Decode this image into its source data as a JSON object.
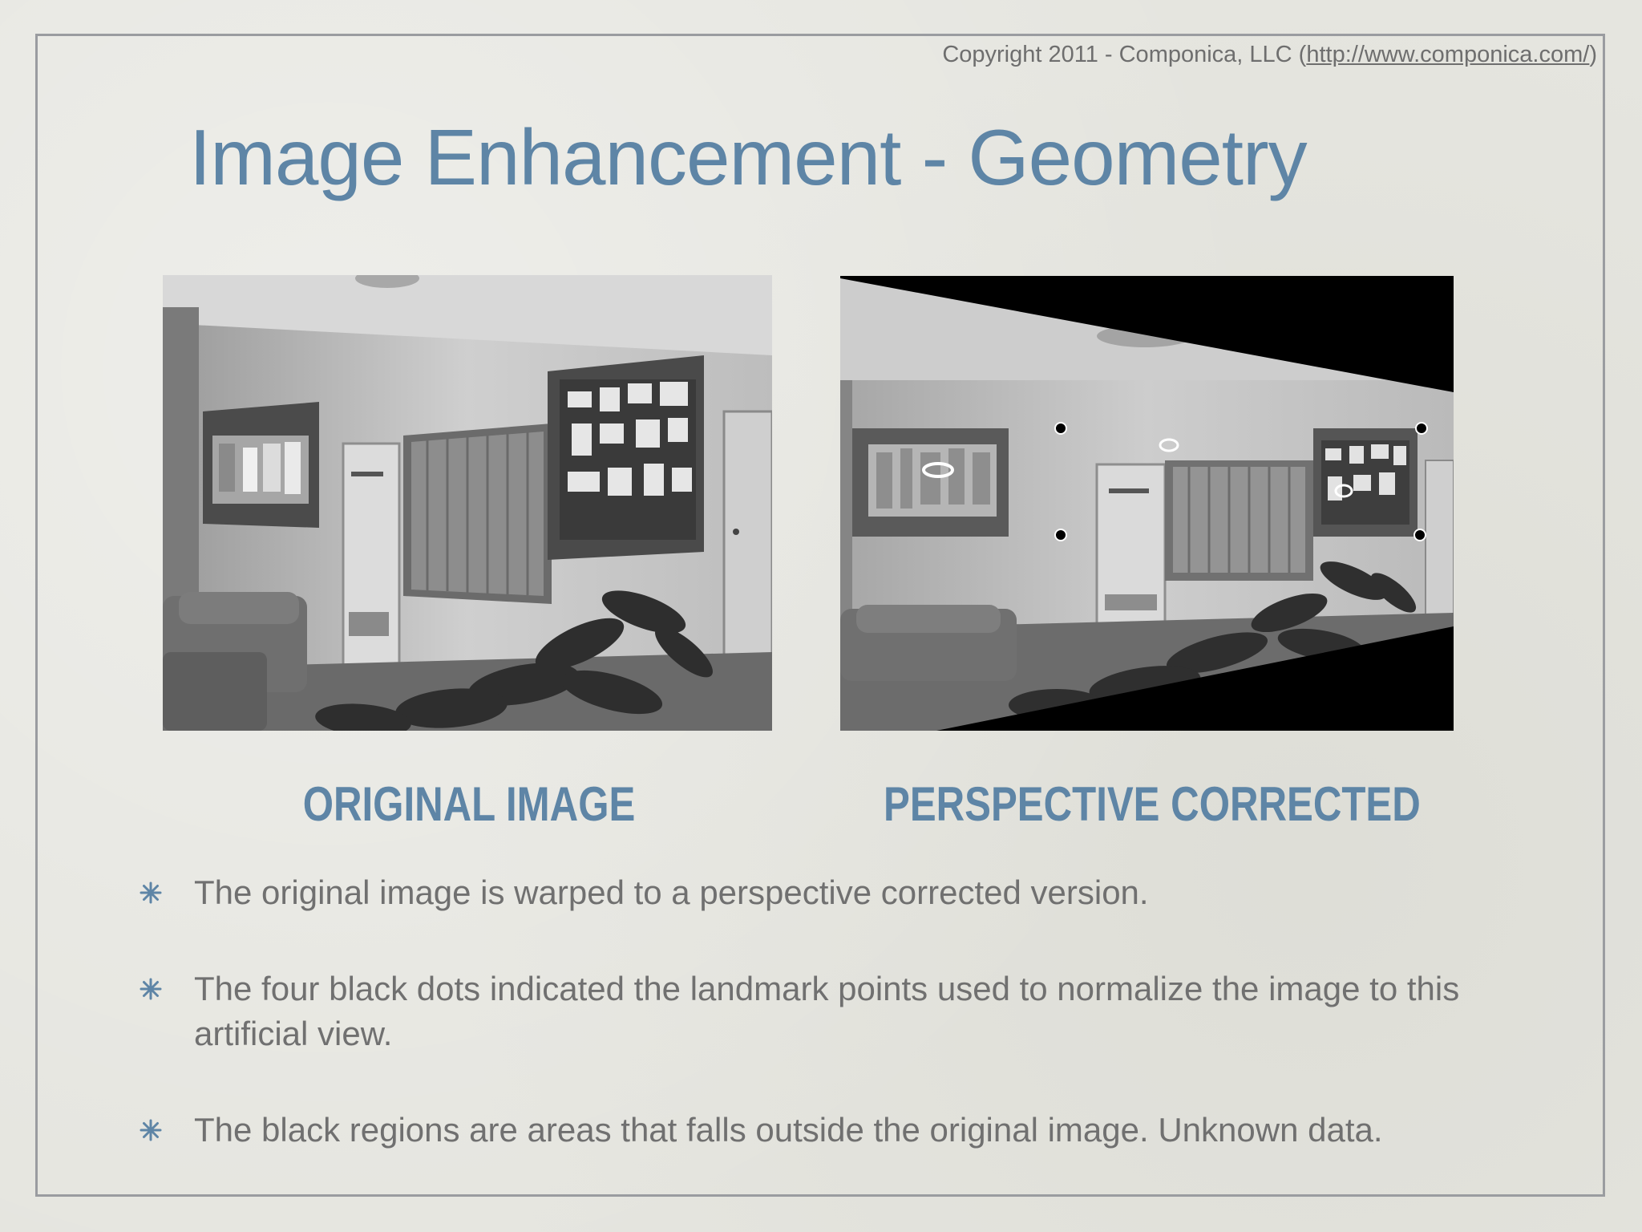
{
  "copyright": {
    "prefix": "Copyright 2011 - Componica, LLC (",
    "link": "http://www.componica.com/",
    "suffix": ")"
  },
  "title": "Image Enhancement - Geometry",
  "images": {
    "left_caption": "ORIGINAL IMAGE",
    "right_caption": "PERSPECTIVE CORRECTED"
  },
  "bullets": [
    "The original image is warped to a perspective corrected version.",
    "The four black dots indicated the landmark points used to normalize the image to this artificial view.",
    "The black regions are areas that falls outside the original image. Unknown data."
  ],
  "colors": {
    "accent": "#5e85a6",
    "body_text": "#707070",
    "frame": "#9a9ca0"
  }
}
